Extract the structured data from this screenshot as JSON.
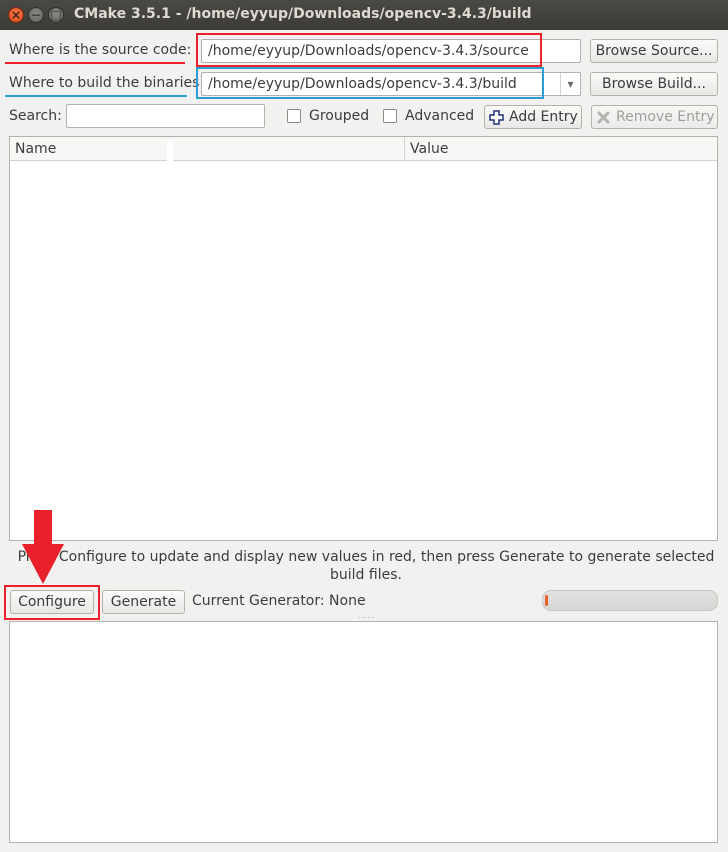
{
  "window": {
    "title": "CMake 3.5.1 - /home/eyyup/Downloads/opencv-3.4.3/build",
    "close_glyph": "×",
    "min_glyph": "−",
    "max_glyph": "□"
  },
  "source": {
    "label": "Where is the source code:",
    "value": "/home/eyyup/Downloads/opencv-3.4.3/source",
    "browse_label": "Browse Source..."
  },
  "build": {
    "label": "Where to build the binaries:",
    "value": "/home/eyyup/Downloads/opencv-3.4.3/build",
    "dropdown_glyph": "▾",
    "browse_label": "Browse Build..."
  },
  "filter": {
    "search_label": "Search:",
    "search_value": "",
    "grouped_label": "Grouped",
    "grouped_checked": false,
    "advanced_label": "Advanced",
    "advanced_checked": false,
    "add_entry_label": "Add Entry",
    "remove_entry_label": "Remove Entry"
  },
  "table": {
    "columns": [
      "Name",
      "Value"
    ],
    "rows": []
  },
  "help_text": "Press Configure to update and display new values in red, then press Generate to generate selected build files.",
  "actions": {
    "configure_label": "Configure",
    "generate_label": "Generate",
    "generator_text": "Current Generator: None",
    "progress": 0
  },
  "colors": {
    "highlight_red": "#e8212b",
    "highlight_blue": "#2a9fd6",
    "progress_accent": "#e8602c"
  },
  "icons": [
    "close-icon",
    "minimize-icon",
    "maximize-icon",
    "dropdown-arrow-icon",
    "add-icon",
    "remove-icon",
    "splitter-grip-icon",
    "annotation-arrow"
  ]
}
